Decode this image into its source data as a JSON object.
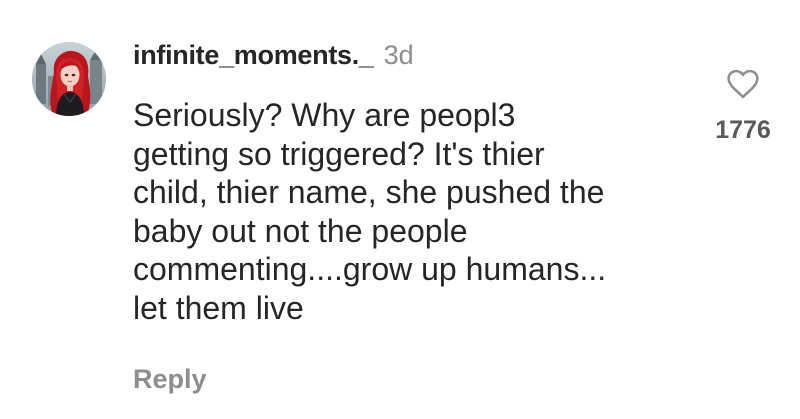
{
  "comment": {
    "username": "infinite_moments._",
    "timestamp": "3d",
    "text": "Seriously? Why are peopl3\ngetting so triggered? It's thier\nchild, thier name, she pushed the\nbaby out not the people\ncommenting....grow up humans...\nlet them live",
    "reply_label": "Reply",
    "like_count": "1776",
    "avatar_icon": "profile-avatar",
    "like_icon": "heart-outline-icon"
  }
}
